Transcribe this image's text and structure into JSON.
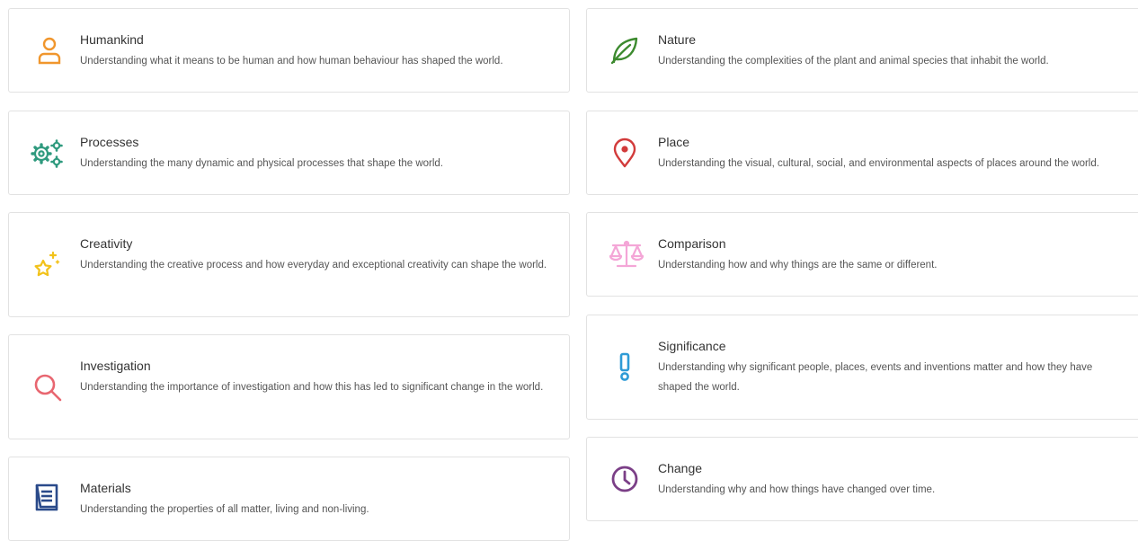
{
  "colors": {
    "humankind": "#f0962d",
    "nature": "#3c8a2e",
    "processes": "#2f9a7e",
    "place": "#d23b3b",
    "creativity": "#f2c21a",
    "comparison": "#f4a6d7",
    "investigation": "#e86670",
    "significance": "#2e9bd6",
    "materials": "#2a4a8a",
    "change": "#7b3f87"
  },
  "cards": {
    "humankind": {
      "icon": "person-icon",
      "title": "Humankind",
      "desc": "Understanding what it means to be human and how human behaviour has shaped the world."
    },
    "nature": {
      "icon": "leaf-icon",
      "title": "Nature",
      "desc": "Understanding the complexities of the plant and animal species that inhabit the world."
    },
    "processes": {
      "icon": "gears-icon",
      "title": "Processes",
      "desc": "Understanding the many dynamic and physical processes that shape the world."
    },
    "place": {
      "icon": "map-pin-icon",
      "title": "Place",
      "desc": "Understanding the visual, cultural, social, and environmental aspects of places around the world."
    },
    "creativity": {
      "icon": "sparkle-star-icon",
      "title": "Creativity",
      "desc": "Understanding the creative process and how everyday and exceptional creativity can shape the world."
    },
    "comparison": {
      "icon": "scales-icon",
      "title": "Comparison",
      "desc": "Understanding how and why things are the same or different."
    },
    "investigation": {
      "icon": "magnifier-icon",
      "title": "Investigation",
      "desc": "Understanding the importance of investigation and how this has led to significant change in the world."
    },
    "significance": {
      "icon": "exclamation-icon",
      "title": "Significance",
      "desc": "Understanding why significant people, places, events and inventions matter and how they have shaped the world."
    },
    "materials": {
      "icon": "book-icon",
      "title": "Materials",
      "desc": "Understanding the properties of all matter, living and non-living."
    },
    "change": {
      "icon": "clock-icon",
      "title": "Change",
      "desc": "Understanding why and how things have changed over time."
    }
  }
}
